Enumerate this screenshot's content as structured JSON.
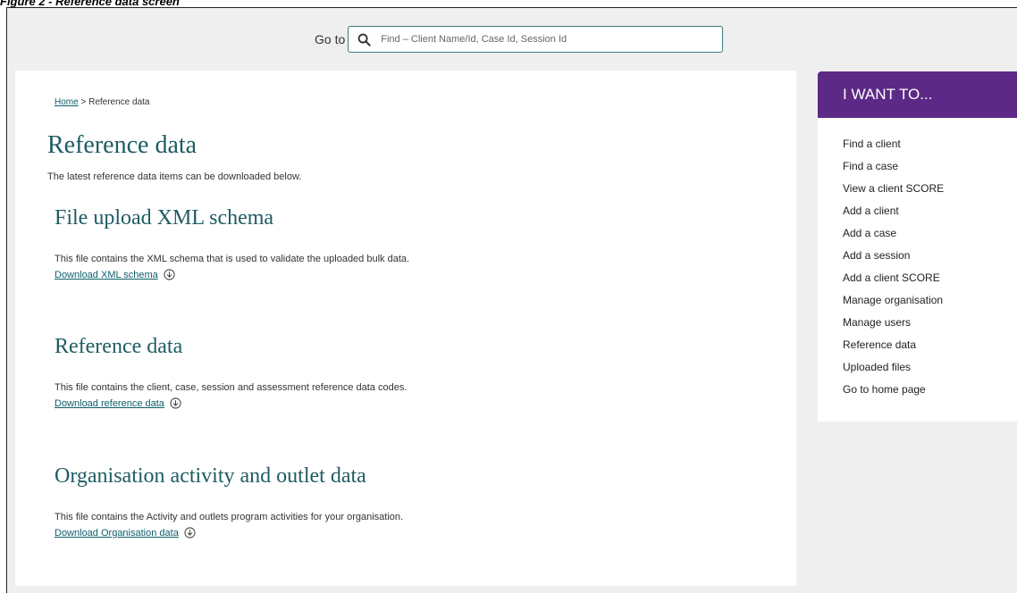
{
  "caption": "Figure 2 - Reference data screen",
  "search": {
    "label": "Go to",
    "placeholder": "Find – Client Name/Id, Case Id, Session Id"
  },
  "breadcrumb": {
    "home": "Home",
    "separator": ">",
    "current": "Reference data"
  },
  "page": {
    "title": "Reference data",
    "intro": "The latest reference data items can be downloaded below."
  },
  "sections": [
    {
      "title": "File upload XML schema",
      "description": "This file contains the XML schema that is used to validate the uploaded bulk data.",
      "link": "Download XML schema"
    },
    {
      "title": "Reference data",
      "description": "This file contains the client, case, session and assessment reference data codes.",
      "link": "Download reference data"
    },
    {
      "title": "Organisation activity and outlet data",
      "description": "This file contains the Activity and outlets program activities for your organisation.",
      "link": "Download Organisation data"
    }
  ],
  "sidebar": {
    "heading": "I WANT TO...",
    "items": [
      "Find a client",
      "Find a case",
      "View a client SCORE",
      "Add a client",
      "Add a case",
      "Add a session",
      "Add a client SCORE",
      "Manage organisation",
      "Manage users",
      "Reference data",
      "Uploaded files",
      "Go to home page"
    ]
  },
  "colors": {
    "accent_teal": "#1e5c63",
    "link": "#0b5e6a",
    "sidebar_header": "#5c2a86",
    "background": "#efefef"
  },
  "icons": [
    "search-icon",
    "download-icon"
  ]
}
